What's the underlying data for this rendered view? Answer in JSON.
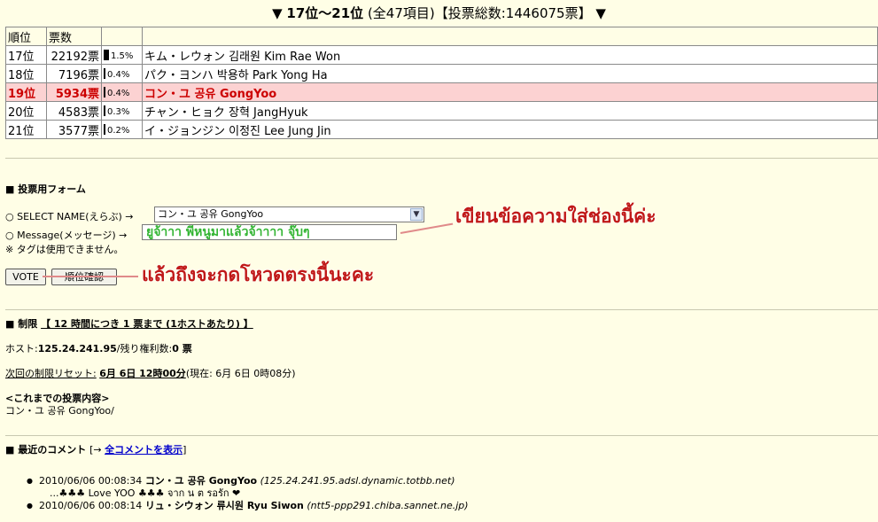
{
  "header": {
    "arrow_left": "▼",
    "range": "17位〜21位",
    "summary": "(全47項目)【投票総数:1446075票】",
    "arrow_right": "▼"
  },
  "table": {
    "headers": [
      "順位",
      "票数",
      ""
    ],
    "rows": [
      {
        "rank": "17位",
        "votes": "22192票",
        "bar_pct": 1.5,
        "pct": "1.5%",
        "name": "キム・レウォン 김래원 Kim Rae Won",
        "highlight": false
      },
      {
        "rank": "18位",
        "votes": "7196票",
        "bar_pct": 0.4,
        "pct": "0.4%",
        "name": "パク・ヨンハ 박용하 Park Yong Ha",
        "highlight": false
      },
      {
        "rank": "19位",
        "votes": "5934票",
        "bar_pct": 0.4,
        "pct": "0.4%",
        "name": "コン・ユ 공유 GongYoo",
        "highlight": true
      },
      {
        "rank": "20位",
        "votes": "4583票",
        "bar_pct": 0.3,
        "pct": "0.3%",
        "name": "チャン・ヒョク 장혁 JangHyuk",
        "highlight": false
      },
      {
        "rank": "21位",
        "votes": "3577票",
        "bar_pct": 0.2,
        "pct": "0.2%",
        "name": "イ・ジョンジン 이정진 Lee Jung Jin",
        "highlight": false
      }
    ]
  },
  "form": {
    "section_title": "■ 投票用フォーム",
    "select_label": "○ SELECT NAME(えらぶ) →",
    "select_value": "コン・ユ 공유 GongYoo",
    "message_label": "○ Message(メッセージ) →",
    "message_value": "ยูจ้าาา พี่หนูมาแล้วจ้าาาา จุ๊บๆ",
    "tag_note": "※ タグは使用できません。",
    "vote_button": "VOTE",
    "rank_button": "順位確認"
  },
  "annotations": {
    "message_hint": "เขียนข้อความใส่ช่องนี้ค่ะ",
    "vote_hint": "แล้วถึงจะกดโหวดตรงนี้นะคะ"
  },
  "limits": {
    "section_title": "■ 制限",
    "rule": "【 12 時間につき 1 票まで (1ホストあたり) 】",
    "host_label": "ホスト:",
    "host_value": "125.24.241.95",
    "remaining_label": "/残り権利数:",
    "remaining_value": "0 票",
    "reset_label": "次回の制限リセット:",
    "reset_value": "6月 6日 12時00分",
    "current_time": "(現在: 6月 6日 0時08分)",
    "history_title": "<これまでの投票内容>",
    "history_value": "コン・ユ 공유 GongYoo/"
  },
  "comments": {
    "section_title": "■ 最近のコメント",
    "link_prefix": "[→ ",
    "show_all": "全コメントを表示",
    "link_suffix": "]",
    "items": [
      {
        "time": "2010/06/06 00:08:34",
        "name": "コン・ユ 공유 GongYoo",
        "host": "(125.24.241.95.adsl.dynamic.totbb.net)",
        "body": "...♣♣♣ Love YOO ♣♣♣ จาก น ต รอรัก ❤"
      },
      {
        "time": "2010/06/06 00:08:14",
        "name": "リュ・シウォン 류시원 Ryu Siwon",
        "host": "(ntt5-ppp291.chiba.sannet.ne.jp)",
        "body": ""
      }
    ]
  },
  "colors": {
    "page_bg": "#fffee6",
    "highlight_row_bg": "#fcd2d2",
    "highlight_text": "#cc0000",
    "annotation_red": "#c01818",
    "message_green": "#33b533",
    "link_blue": "#0000cc"
  }
}
